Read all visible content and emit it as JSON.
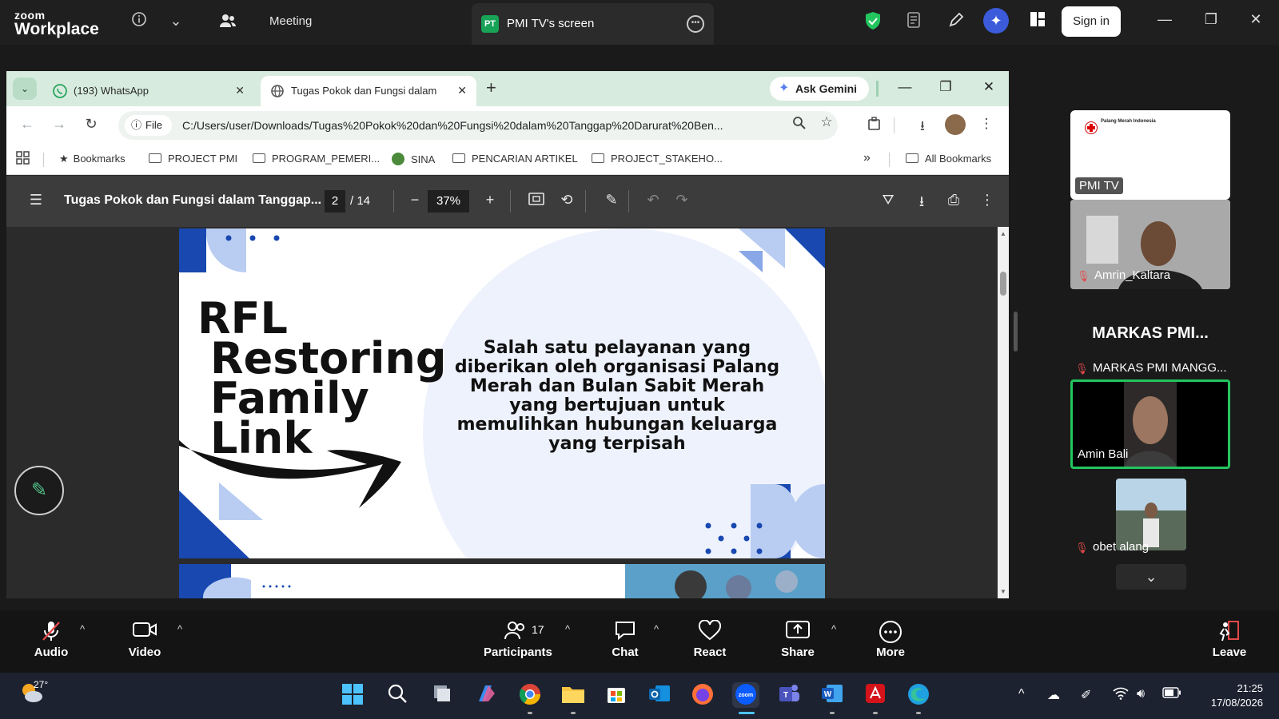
{
  "zoom": {
    "brand_top": "zoom",
    "brand_bottom": "Workplace",
    "meeting_label": "Meeting",
    "screen_badge": "PT",
    "screen_title": "PMI TV's screen",
    "sign_in": "Sign in"
  },
  "browser": {
    "tabs": [
      {
        "title": "(193) WhatsApp",
        "icon": "whatsapp-icon"
      },
      {
        "title": "Tugas Pokok dan Fungsi dalam",
        "icon": "globe-icon"
      }
    ],
    "ask_gemini": "Ask Gemini",
    "file_chip": "File",
    "url": "C:/Users/user/Downloads/Tugas%20Pokok%20dan%20Fungsi%20dalam%20Tanggap%20Darurat%20Ben...",
    "bookmarks": [
      "Bookmarks",
      "PROJECT PMI",
      "PROGRAM_PEMERI...",
      "SINA",
      "PENCARIAN ARTIKEL",
      "PROJECT_STAKEHO..."
    ],
    "all_bookmarks": "All Bookmarks"
  },
  "pdf": {
    "title": "Tugas Pokok dan Fungsi dalam Tanggap...",
    "page": "2",
    "total": "/ 14",
    "zoom": "37%"
  },
  "slide": {
    "line1": "RFL",
    "line2": "Restoring",
    "line3": "Family",
    "line4": "Link",
    "description": "Salah satu pelayanan yang diberikan oleh organisasi Palang Merah dan Bulan Sabit Merah yang bertujuan untuk memulihkan hubungan keluarga yang terpisah"
  },
  "participants_panel": {
    "pmi_logo_text": "Palang Merah Indonesia",
    "pmi_tv": "PMI TV",
    "amrin": "Amrin_Kaltara",
    "markas_heading": "MARKAS PMI...",
    "markas_tile": "MARKAS PMI MANGG...",
    "amin": "Amin Bali",
    "obet": "obet alang"
  },
  "bottom_bar": {
    "audio": "Audio",
    "video": "Video",
    "participants": "Participants",
    "participants_count": "17",
    "chat": "Chat",
    "react": "React",
    "share": "Share",
    "more": "More",
    "leave": "Leave"
  },
  "taskbar": {
    "weather": "27°",
    "time": "21:25",
    "date": "17/08/2026"
  },
  "colors": {
    "zoom_bg": "#1f1f1f",
    "chrome_tabstrip": "#d7ecdf",
    "slide_blue": "#1848b0",
    "slide_light": "#b9cdf2",
    "active_speaker": "#22c55e"
  }
}
